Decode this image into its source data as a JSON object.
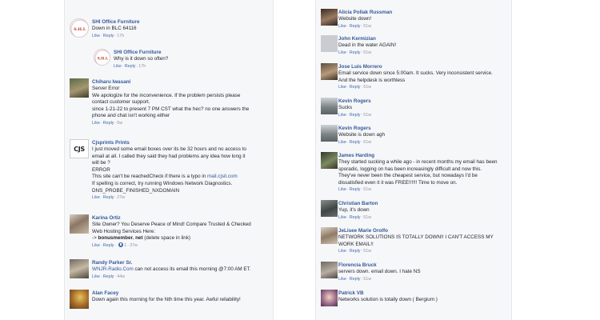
{
  "left_comments": [
    {
      "author": "SHI Office Furniture",
      "avatar_text": "S.H.I.",
      "lines": [
        "Down in BLC 64116"
      ],
      "actions": {
        "like": "Like",
        "reply": "Reply",
        "time": "17h"
      }
    },
    {
      "author": "SHI Office Furniture",
      "avatar_text": "S.H.I.",
      "lines": [
        "Why is it down so often?"
      ],
      "actions": {
        "like": "Like",
        "reply": "Reply",
        "time": "17h"
      }
    },
    {
      "author": "Chiharu Iwasani",
      "lines": [
        "Server Error",
        "We apologize for the inconvenience. If the problem persists please",
        "contact customer support.",
        "since 1-21-22 to present 7 PM CST what the hec? no one answers the",
        "phone and chat isn't working either"
      ],
      "actions": {
        "like": "Like",
        "reply": "Reply",
        "time": "5w"
      }
    },
    {
      "author": "Cjsprints Prints",
      "avatar_text": "CJS",
      "lines": [
        "I just moved some email boxes over its be 32 hours and no access to",
        "email at all. I called they said they had problems any idea how long it",
        "will be ?",
        "ERROR",
        "This site can't be reachedCheck if there is a typo in ",
        "If spelling is correct, try running Windows Network Diagnostics.",
        "DNS_PROBE_FINISHED_NXDOMAIN"
      ],
      "link_text": "mail.cjsit.com",
      "actions": {
        "like": "Like",
        "reply": "Reply",
        "time": "27w"
      }
    },
    {
      "author": "Karina Ortiz",
      "lines": [
        "Site Owner? You Deserve Peace of Mind! Compare Trusted & Checked",
        "Web Hosting Services Here:",
        "-> bonusmember. net (delete space in link)"
      ],
      "actions": {
        "like": "Like",
        "reply": "Reply",
        "likes": "1",
        "time": "37w"
      }
    },
    {
      "author": "Randy Parker Sr.",
      "link_text": "WNJR-Radio.Com",
      "lines": [
        " can not access its email this morning @7:00 AM ET."
      ],
      "actions": {
        "like": "Like",
        "reply": "Reply",
        "time": "44w"
      }
    },
    {
      "author": "Alan Facey",
      "lines": [
        "Down again this morning for the Nth time this year. Awful reliability!"
      ]
    }
  ],
  "right_comments": [
    {
      "author": "Alicia Pollak Russman",
      "lines": [
        "Website down!"
      ],
      "actions": {
        "like": "Like",
        "reply": "Reply",
        "time": "51w"
      }
    },
    {
      "author": "John Kermizian",
      "lines": [
        "Dead in the water AGAIN!"
      ],
      "actions": {
        "like": "Like",
        "reply": "Reply",
        "time": "51w"
      }
    },
    {
      "author": "Jose Luis Morrero",
      "lines": [
        "Email service down since 5:00am. It sucks. Very inconsistent service.",
        "And the helpdesk is worthless"
      ],
      "actions": {
        "like": "Like",
        "reply": "Reply",
        "time": "51w"
      }
    },
    {
      "author": "Kevin Rogers",
      "lines": [
        "Sucks"
      ],
      "actions": {
        "like": "Like",
        "reply": "Reply",
        "time": "51w"
      }
    },
    {
      "author": "Kevin Rogers",
      "lines": [
        "Website is down agh"
      ],
      "actions": {
        "like": "Like",
        "reply": "Reply",
        "time": "51w"
      }
    },
    {
      "author": "James Harding",
      "lines": [
        "They started sucking a while ago - in recent months my email has been",
        "sporadic, logging on has been increasingly difficult and now this.",
        "They've never been the cheapest service, but nowadays I'd be",
        "dissatisfied even it it was FREE!!!!!! Time to move on."
      ],
      "actions": {
        "like": "Like",
        "reply": "Reply",
        "time": "51w"
      }
    },
    {
      "author": "Christian Barton",
      "lines": [
        "Yup, it's down"
      ],
      "actions": {
        "like": "Like",
        "reply": "Reply",
        "time": "51w"
      }
    },
    {
      "author": "JeLisee Marie Orolfo",
      "lines": [
        "NETWORK SOLUTIONS IS TOTALLY DOWN!! I CAN'T ACCESS MY",
        "WORK EMAIL!!"
      ],
      "actions": {
        "like": "Like",
        "reply": "Reply",
        "time": "51w"
      }
    },
    {
      "author": "Florencia Bruck",
      "lines": [
        "servers down. email down. I hate NS"
      ],
      "actions": {
        "like": "Like",
        "reply": "Reply",
        "time": "51w"
      }
    },
    {
      "author": "Patrick VB",
      "lines": [
        "Networks solution is totally down ( Bergium )"
      ]
    }
  ],
  "colors": {
    "link": "#365899",
    "meta": "#90949c",
    "background": "#f6f7f9"
  }
}
